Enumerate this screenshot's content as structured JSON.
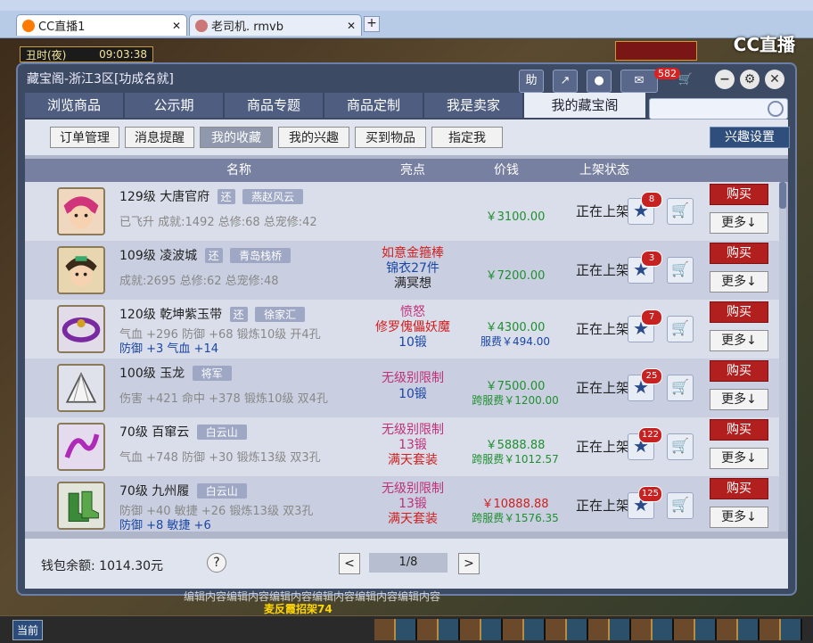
{
  "browser": {
    "tabs": [
      {
        "label": "CC直播1"
      },
      {
        "label": "老司机. rmvb"
      }
    ],
    "new_tab": "+"
  },
  "game": {
    "time": "丑时(夜)",
    "clock": "09:03:38",
    "cc_logo": "CC直播",
    "bottom_current": "当前",
    "ghost_text": "编辑内容编辑内容编辑内容编辑内容编辑内容编辑内容",
    "gold_text": "麦反霞招架74"
  },
  "panel": {
    "title": "藏宝阁-浙江3区[功成名就]",
    "toolbar": {
      "help": "助",
      "badge": "582"
    },
    "nav": [
      "浏览商品",
      "公示期",
      "商品专题",
      "商品定制",
      "我是卖家",
      "我的藏宝阁"
    ],
    "subnav": [
      "订单管理",
      "消息提醒",
      "我的收藏",
      "我的兴趣",
      "买到物品",
      "指定我"
    ],
    "interest_settings": "兴趣设置",
    "columns": {
      "name": "名称",
      "highlight": "亮点",
      "price": "价钱",
      "status": "上架状态"
    },
    "rows": [
      {
        "level": "129级",
        "name": "大唐官府",
        "tag1": "还",
        "tag2": "燕赵风云",
        "detail1": "已飞升 成就:1492 总修:68 总宠修:42",
        "detail2": "",
        "hl1": "",
        "hl2": "",
        "hl3": "",
        "price": "￥3100.00",
        "fee": "",
        "status": "正在上架",
        "fav": "8",
        "buy": "购买",
        "more": "更多↓"
      },
      {
        "level": "109级",
        "name": "凌波城",
        "tag1": "还",
        "tag2": "青岛栈桥",
        "detail1": "成就:2695 总修:62 总宠修:48",
        "detail2": "",
        "hl1": "如意金箍棒",
        "hl2": "锦衣27件",
        "hl3": "满冥想",
        "price": "￥7200.00",
        "fee": "",
        "status": "正在上架",
        "fav": "3",
        "buy": "购买",
        "more": "更多↓"
      },
      {
        "level": "120级",
        "name": "乾坤紫玉带",
        "tag1": "还",
        "tag2": "徐家汇",
        "detail1": "气血 +296 防御 +68 锻炼10级 开4孔",
        "detail2": "防御 +3 气血 +14",
        "hl1": "愤怒",
        "hl2": "修罗傀儡妖魔",
        "hl3": "10锻",
        "price": "￥4300.00",
        "fee": "服费￥494.00",
        "status": "正在上架",
        "fav": "7",
        "buy": "购买",
        "more": "更多↓"
      },
      {
        "level": "100级",
        "name": "玉龙",
        "tag1": "将军",
        "tag2": "",
        "detail1": "伤害 +421 命中 +378 锻炼10级 双4孔",
        "detail2": "",
        "hl1": "无级别限制",
        "hl2": "10锻",
        "hl3": "",
        "price": "￥7500.00",
        "fee": "跨服费￥1200.00",
        "status": "正在上架",
        "fav": "25",
        "buy": "购买",
        "more": "更多↓"
      },
      {
        "level": "70级",
        "name": "百窜云",
        "tag1": "白云山",
        "tag2": "",
        "detail1": "气血 +748 防御 +30 锻炼13级 双3孔",
        "detail2": "",
        "hl1": "无级别限制",
        "hl2": "13锻",
        "hl3": "满天套装",
        "price": "￥5888.88",
        "fee": "跨服费￥1012.57",
        "status": "正在上架",
        "fav": "122",
        "buy": "购买",
        "more": "更多↓"
      },
      {
        "level": "70级",
        "name": "九州履",
        "tag1": "白云山",
        "tag2": "",
        "detail1": "防御 +40 敏捷 +26 锻炼13级 双3孔",
        "detail2": "防御 +8 敏捷 +6",
        "hl1": "无级别限制",
        "hl2": "13锻",
        "hl3": "满天套装",
        "price": "￥10888.88",
        "fee": "跨服费￥1576.35",
        "status": "正在上架",
        "fav": "125",
        "buy": "购买",
        "more": "更多↓"
      }
    ],
    "footer": {
      "wallet": "钱包余额: 1014.30元",
      "help": "?",
      "prev": "<",
      "page": "1/8",
      "next": ">"
    }
  },
  "colors": {
    "accent_red": "#b21f1f",
    "nav_blue": "#4f5e80",
    "price_green": "#1f8f2f",
    "price_red": "#d11f1f"
  }
}
